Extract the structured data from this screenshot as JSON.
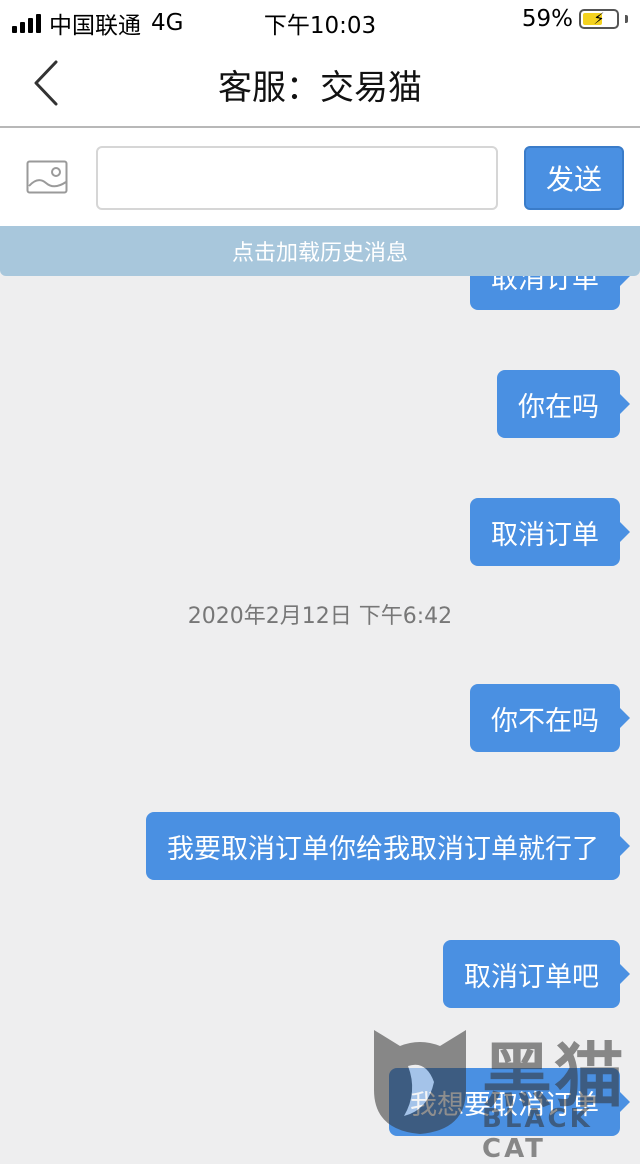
{
  "status_bar": {
    "carrier": "中国联通",
    "network": "4G",
    "time": "下午10:03",
    "battery_percent": "59%",
    "battery_level": 0.59
  },
  "nav": {
    "title": "客服：交易猫",
    "back_icon": "chevron-left-icon"
  },
  "composer": {
    "image_icon": "image-icon",
    "input_value": "",
    "send_label": "发送"
  },
  "chat": {
    "load_history": "点击加载历史消息",
    "messages": [
      {
        "text": "取消订单"
      },
      {
        "text": "你在吗"
      },
      {
        "text": "取消订单"
      },
      {
        "text": "你不在吗"
      },
      {
        "text": "我要取消订单你给我取消订单就行了"
      },
      {
        "text": "取消订单吧"
      },
      {
        "text": "我想要取消订单"
      }
    ],
    "timestamp": "2020年2月12日 下午6:42"
  },
  "watermark": {
    "cn": "黑猫",
    "en": "BLACK CAT"
  },
  "colors": {
    "bubble": "#4a90e2",
    "load_history_bar": "#a8c7dc",
    "chat_background": "#eeeeef"
  }
}
